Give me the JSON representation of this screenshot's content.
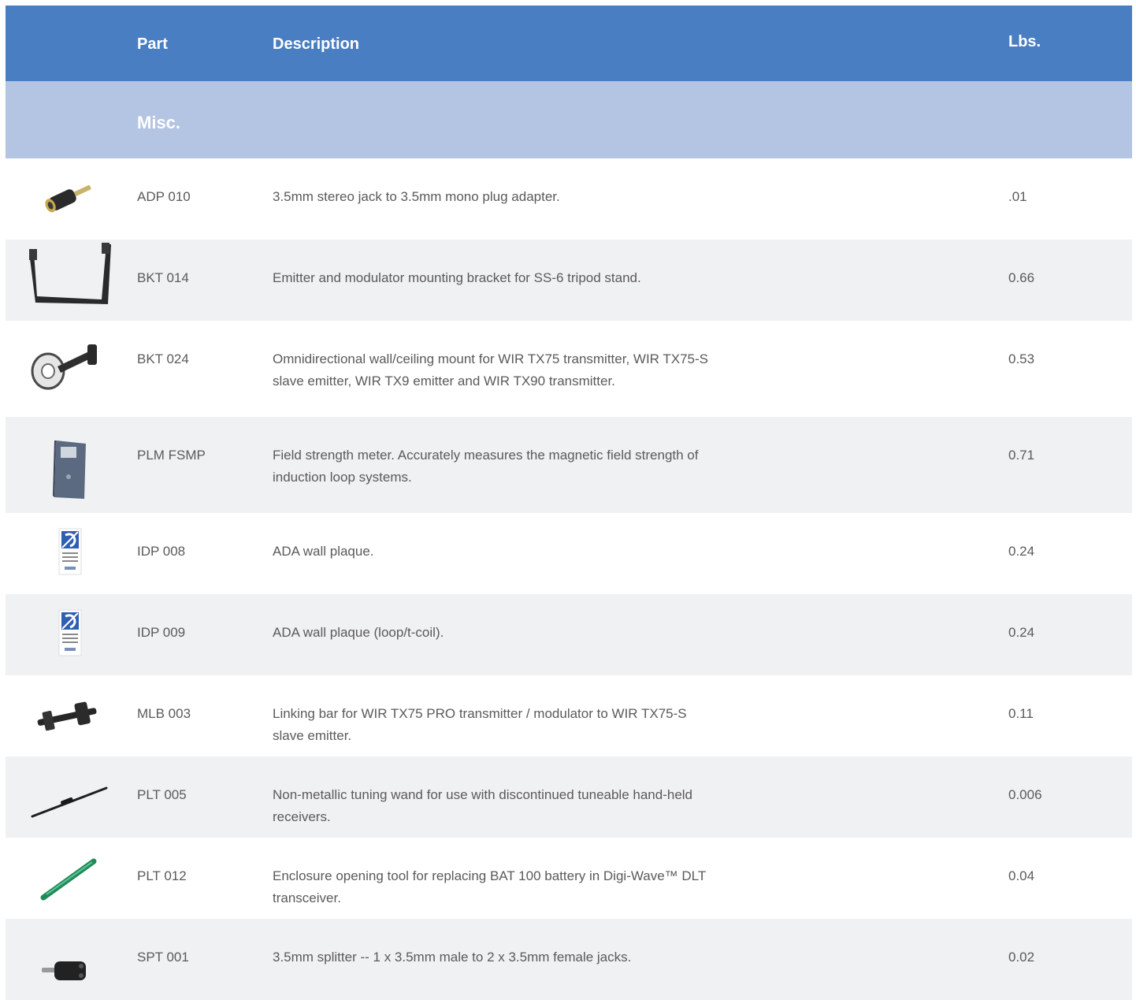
{
  "header": {
    "part": "Part",
    "description": "Description",
    "lbs": "Lbs."
  },
  "section": {
    "title": "Misc."
  },
  "rows": [
    {
      "part": "ADP 010",
      "description": "3.5mm stereo jack to 3.5mm mono plug adapter.",
      "lbs": ".01",
      "icon": "audio-adapter-icon"
    },
    {
      "part": "BKT 014",
      "description": "Emitter and modulator mounting bracket for SS-6 tripod stand.",
      "lbs": "0.66",
      "icon": "bracket-icon"
    },
    {
      "part": "BKT 024",
      "description": "Omnidirectional wall/ceiling mount for WIR TX75 transmitter, WIR TX75-S slave emitter, WIR TX9 emitter and WIR TX90 transmitter.",
      "lbs": "0.53",
      "icon": "wall-mount-icon"
    },
    {
      "part": "PLM FSMP",
      "description": "Field strength meter. Accurately measures the magnetic field strength of induction loop systems.",
      "lbs": "0.71",
      "icon": "field-meter-icon"
    },
    {
      "part": "IDP 008",
      "description": "ADA wall plaque.",
      "lbs": "0.24",
      "icon": "ada-plaque-icon"
    },
    {
      "part": "IDP 009",
      "description": "ADA wall plaque (loop/t-coil).",
      "lbs": "0.24",
      "icon": "ada-plaque-icon"
    },
    {
      "part": "MLB 003",
      "description": "Linking bar for WIR TX75 PRO transmitter / modulator to WIR TX75-S slave emitter.",
      "lbs": "0.11",
      "icon": "linking-bar-icon"
    },
    {
      "part": "PLT 005",
      "description": "Non-metallic tuning wand for use with discontinued tuneable hand-held receivers.",
      "lbs": "0.006",
      "icon": "tuning-wand-icon"
    },
    {
      "part": "PLT 012",
      "description": "Enclosure opening tool for replacing BAT 100 battery in Digi-Wave™ DLT transceiver.",
      "lbs": "0.04",
      "icon": "opening-tool-icon"
    },
    {
      "part": "SPT 001",
      "description": "3.5mm splitter -- 1 x 3.5mm male to 2 x 3.5mm female jacks.",
      "lbs": "0.02",
      "icon": "splitter-icon"
    }
  ],
  "colors": {
    "header": "#4a7ec2",
    "section": "#b4c4e3",
    "alt_row": "#f0f1f3",
    "text": "#5a5a5a"
  }
}
